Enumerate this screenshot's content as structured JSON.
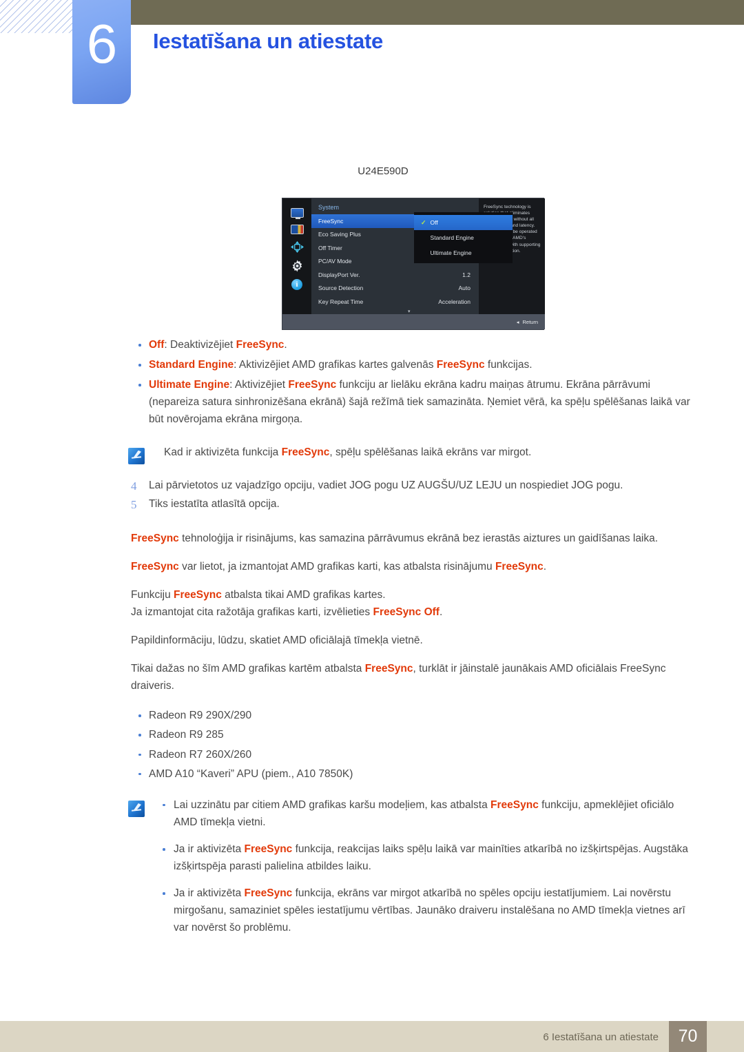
{
  "header": {
    "chapter_number": "6",
    "chapter_title": "Iestatīšana un atiestate"
  },
  "model_label": "U24E590D",
  "osd": {
    "menu_title": "System",
    "rows": [
      {
        "label": "FreeSync",
        "value": "",
        "selected": true
      },
      {
        "label": "Eco Saving Plus",
        "value": ""
      },
      {
        "label": "Off Timer",
        "value": ""
      },
      {
        "label": "PC/AV Mode",
        "value": "▸"
      },
      {
        "label": "DisplayPort Ver.",
        "value": "1.2"
      },
      {
        "label": "Source Detection",
        "value": "Auto"
      },
      {
        "label": "Key Repeat Time",
        "value": "Acceleration"
      }
    ],
    "popup_options": [
      {
        "label": "Off",
        "selected": true
      },
      {
        "label": "Standard Engine",
        "selected": false
      },
      {
        "label": "Ultimate Engine",
        "selected": false
      }
    ],
    "help_text": "FreeSync technology is solution that eliminates screen tearing without all the usual lag and latency. FreeSync can be operated when you use AMD's graphic card with supporting Freesync solution.",
    "return_label": "Return",
    "rail_icons": [
      "display-icon",
      "picture-icon",
      "arrows-icon",
      "gear-icon",
      "info-icon"
    ],
    "scroll_down_glyph": "▾",
    "return_glyph": "◂"
  },
  "option_bullets": [
    {
      "term": "Off",
      "segments": [
        {
          "t": ": Deaktivizējiet ",
          "s": "normal"
        },
        {
          "t": "FreeSync",
          "s": "red"
        },
        {
          "t": ".",
          "s": "normal"
        }
      ]
    },
    {
      "term": "Standard Engine",
      "segments": [
        {
          "t": ": Aktivizējiet AMD grafikas kartes galvenās ",
          "s": "normal"
        },
        {
          "t": "FreeSync",
          "s": "red"
        },
        {
          "t": " funkcijas.",
          "s": "normal"
        }
      ]
    },
    {
      "term": "Ultimate Engine",
      "segments": [
        {
          "t": ": Aktivizējiet ",
          "s": "normal"
        },
        {
          "t": "FreeSync",
          "s": "red"
        },
        {
          "t": " funkciju ar lielāku ekrāna kadru maiņas ātrumu. Ekrāna pārrāvumi (nepareiza satura sinhronizēšana ekrānā) šajā režīmā tiek samazināta. Ņemiet vērā, ka spēļu spēlēšanas laikā var būt novērojama ekrāna mirgoņa.",
          "s": "normal"
        }
      ]
    }
  ],
  "note1": {
    "icon": "note-icon",
    "segments": [
      {
        "t": "Kad ir aktivizēta funkcija ",
        "s": "normal"
      },
      {
        "t": "FreeSync",
        "s": "red"
      },
      {
        "t": ", spēļu spēlēšanas laikā ekrāns var mirgot.",
        "s": "normal"
      }
    ]
  },
  "steps": [
    {
      "num": "4",
      "text": "Lai pārvietotos uz vajadzīgo opciju, vadiet JOG pogu UZ AUGŠU/UZ LEJU un nospiediet JOG pogu."
    },
    {
      "num": "5",
      "text": "Tiks iestatīta atlasītā opcija."
    }
  ],
  "paragraphs": [
    [
      {
        "t": "FreeSync",
        "s": "red"
      },
      {
        "t": " tehnoloģija ir risinājums, kas samazina pārrāvumus ekrānā bez ierastās aiztures un gaidīšanas laika.",
        "s": "normal"
      }
    ],
    [
      {
        "t": "FreeSync",
        "s": "red"
      },
      {
        "t": " var lietot, ja izmantojat AMD grafikas karti, kas atbalsta risinājumu ",
        "s": "normal"
      },
      {
        "t": "FreeSync",
        "s": "red"
      },
      {
        "t": ".",
        "s": "normal"
      }
    ],
    [
      {
        "t": "Funkciju ",
        "s": "normal"
      },
      {
        "t": "FreeSync",
        "s": "red"
      },
      {
        "t": " atbalsta tikai AMD grafikas kartes.",
        "s": "normal"
      }
    ],
    [
      {
        "t": "Ja izmantojat cita ražotāja grafikas karti, izvēlieties ",
        "s": "normal"
      },
      {
        "t": "FreeSync Off",
        "s": "red"
      },
      {
        "t": ".",
        "s": "normal"
      }
    ],
    [
      {
        "t": "Papildinformāciju, lūdzu, skatiet AMD oficiālajā tīmekļa vietnē.",
        "s": "normal"
      }
    ],
    [
      {
        "t": "Tikai dažas no šīm AMD grafikas kartēm atbalsta ",
        "s": "normal"
      },
      {
        "t": "FreeSync",
        "s": "red"
      },
      {
        "t": ", turklāt ir jāinstalē jaunākais AMD oficiālais FreeSync draiveris.",
        "s": "normal"
      }
    ]
  ],
  "card_list": [
    "Radeon R9 290X/290",
    "Radeon R9 285",
    "Radeon R7 260X/260",
    "AMD A10 “Kaveri” APU (piem., A10 7850K)"
  ],
  "note2": {
    "icon": "note-icon",
    "bullets": [
      [
        {
          "t": "Lai uzzinātu par citiem AMD grafikas karšu modeļiem, kas atbalsta ",
          "s": "normal"
        },
        {
          "t": "FreeSync",
          "s": "red"
        },
        {
          "t": " funkciju, apmeklējiet oficiālo AMD tīmekļa vietni.",
          "s": "normal"
        }
      ],
      [
        {
          "t": "Ja ir aktivizēta ",
          "s": "normal"
        },
        {
          "t": "FreeSync",
          "s": "red"
        },
        {
          "t": " funkcija, reakcijas laiks spēļu laikā var mainīties atkarībā no izšķirtspējas. Augstāka izšķirtspēja parasti palielina atbildes laiku.",
          "s": "normal"
        }
      ],
      [
        {
          "t": "Ja ir aktivizēta ",
          "s": "normal"
        },
        {
          "t": "FreeSync",
          "s": "red"
        },
        {
          "t": " funkcija, ekrāns var mirgot atkarībā no spēles opciju iestatījumiem. Lai novērstu mirgošanu, samaziniet spēles iestatījumu vērtības. Jaunāko draiveru instalēšana no AMD tīmekļa vietnes arī var novērst šo problēmu.",
          "s": "normal"
        }
      ]
    ]
  },
  "footer": {
    "text": "6 Iestatīšana un atiestate",
    "page_number": "70"
  },
  "colors": {
    "accent_red": "#e23a0a",
    "chapter_blue": "#2552e0",
    "olive": "#6f6b54",
    "footer_bg": "#dcd6c4",
    "page_box": "#938878"
  }
}
